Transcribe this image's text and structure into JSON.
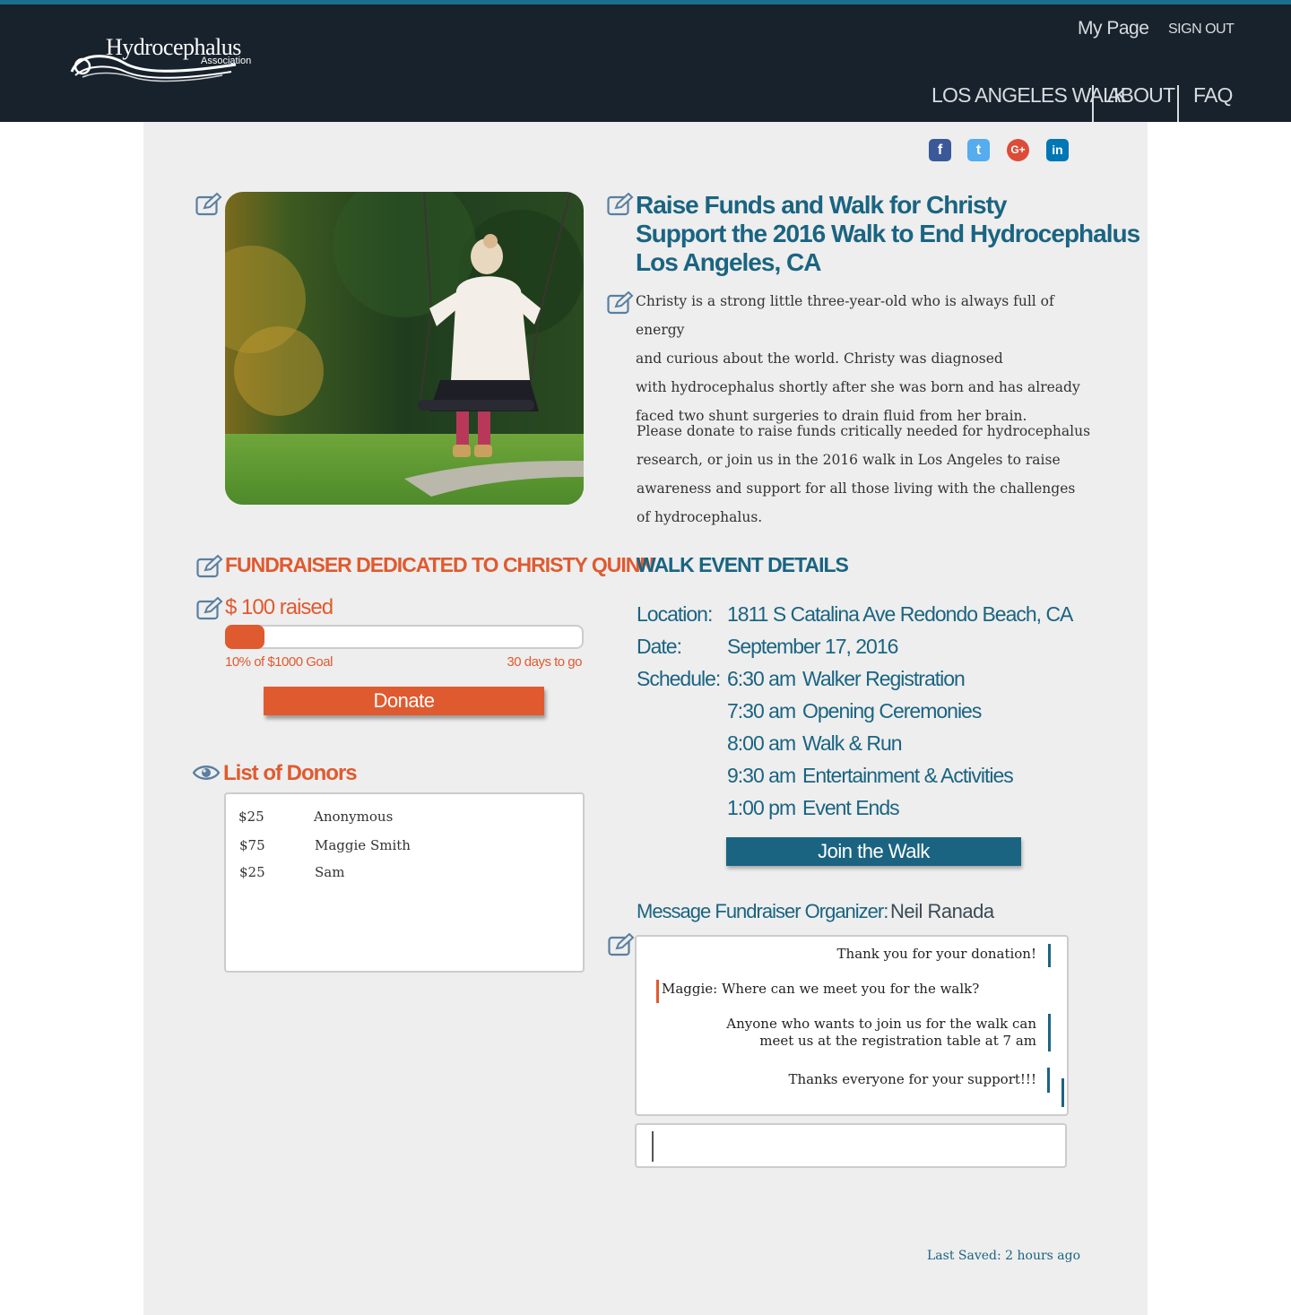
{
  "header": {
    "logo_text": "Hydrocephalus",
    "logo_sub": "Association",
    "my_page": "My Page",
    "sign_out": "SIGN OUT",
    "nav": [
      "LOS ANGELES WALK",
      "ABOUT",
      "FAQ"
    ]
  },
  "social": {
    "facebook": "f",
    "twitter": "t",
    "google_plus": "G+",
    "linkedin": "in"
  },
  "campaign": {
    "title_lines": [
      "Raise Funds and Walk for Christy",
      "Support the 2016 Walk to End Hydrocephalus",
      "Los Angeles, CA"
    ],
    "paragraph1_lines": [
      "Christy is a strong little three-year-old who is always full of energy",
      "and curious about the world.  Christy was diagnosed",
      "with hydrocephalus shortly after she was born and has already",
      "faced two shunt surgeries to drain fluid from her brain."
    ],
    "paragraph2_lines": [
      "Please donate to raise funds critically needed for hydrocephalus",
      "research, or join us in the 2016 walk in Los Angeles to raise",
      "awareness and support for all those living with the challenges",
      "of hydrocephalus."
    ]
  },
  "fundraiser": {
    "dedication": "FUNDRAISER DEDICATED TO CHRISTY QUINN",
    "raised": "$ 100 raised",
    "progress_fraction": 0.1,
    "goal_text": "10% of $1000 Goal",
    "days_text": "30 days to go",
    "donate_label": "Donate"
  },
  "donors": {
    "title": "List of Donors",
    "rows": [
      {
        "amount": "$25",
        "name": "Anonymous"
      },
      {
        "amount": "$75",
        "name": "Maggie Smith"
      },
      {
        "amount": "$25",
        "name": "Sam"
      }
    ]
  },
  "walk": {
    "title": "WALK EVENT DETAILS",
    "location_label": "Location:",
    "location": "1811 S Catalina Ave Redondo Beach, CA",
    "date_label": "Date:",
    "date": "September 17, 2016",
    "schedule_label": "Schedule:",
    "schedule": [
      {
        "time": "6:30 am",
        "event": "Walker Registration"
      },
      {
        "time": "7:30 am",
        "event": "Opening Ceremonies"
      },
      {
        "time": "8:00 am",
        "event": "Walk & Run"
      },
      {
        "time": "9:30 am",
        "event": "Entertainment & Activities"
      },
      {
        "time": "1:00 pm",
        "event": "Event Ends"
      }
    ],
    "join_label": "Join the Walk"
  },
  "messages": {
    "label": "Message Fundraiser Organizer:",
    "organizer": "Neil Ranada",
    "items": [
      {
        "text": "Thank you for your donation!",
        "from": "organizer"
      },
      {
        "text": "Maggie:  Where can we meet you for the walk?",
        "from": "donor"
      },
      {
        "text_lines": [
          "Anyone who wants to join us for the walk  can",
          "meet us at the registration table at 7 am"
        ],
        "from": "organizer"
      },
      {
        "text": "Thanks everyone for your support!!!",
        "from": "organizer"
      }
    ],
    "input_value": ""
  },
  "status": {
    "last_saved": "Last Saved: 2 hours ago"
  },
  "colors": {
    "accent_teal": "#1a6482",
    "accent_orange": "#e05a2f",
    "header_bg": "#18222c",
    "panel_bg": "#eeeeee"
  }
}
